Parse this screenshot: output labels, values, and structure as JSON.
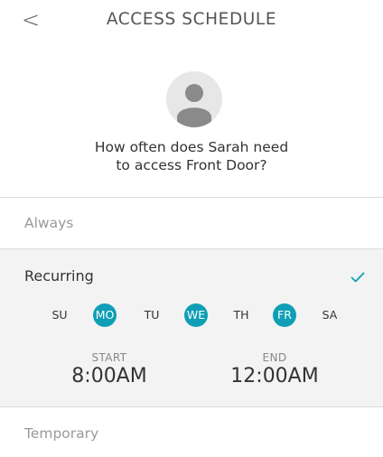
{
  "header": {
    "back_icon": "chevron-left-icon",
    "back_glyph": "<",
    "title": "ACCESS SCHEDULE"
  },
  "user": {
    "avatar_icon": "user-avatar-icon"
  },
  "question": {
    "line1": "How often does Sarah need",
    "line2": "to access Front Door?"
  },
  "options": {
    "always": "Always",
    "recurring": "Recurring",
    "temporary": "Temporary"
  },
  "recurring": {
    "selected_icon": "checkmark-icon",
    "days": [
      {
        "label": "SU",
        "selected": false
      },
      {
        "label": "MO",
        "selected": true
      },
      {
        "label": "TU",
        "selected": false
      },
      {
        "label": "WE",
        "selected": true
      },
      {
        "label": "TH",
        "selected": false
      },
      {
        "label": "FR",
        "selected": true
      },
      {
        "label": "SA",
        "selected": false
      }
    ],
    "start_caption": "START",
    "start_time": "8:00AM",
    "end_caption": "END",
    "end_time": "12:00AM"
  },
  "colors": {
    "accent": "#0e9fb6",
    "selected_bg": "#f3f3f3",
    "muted_text": "#9a9a9a"
  }
}
